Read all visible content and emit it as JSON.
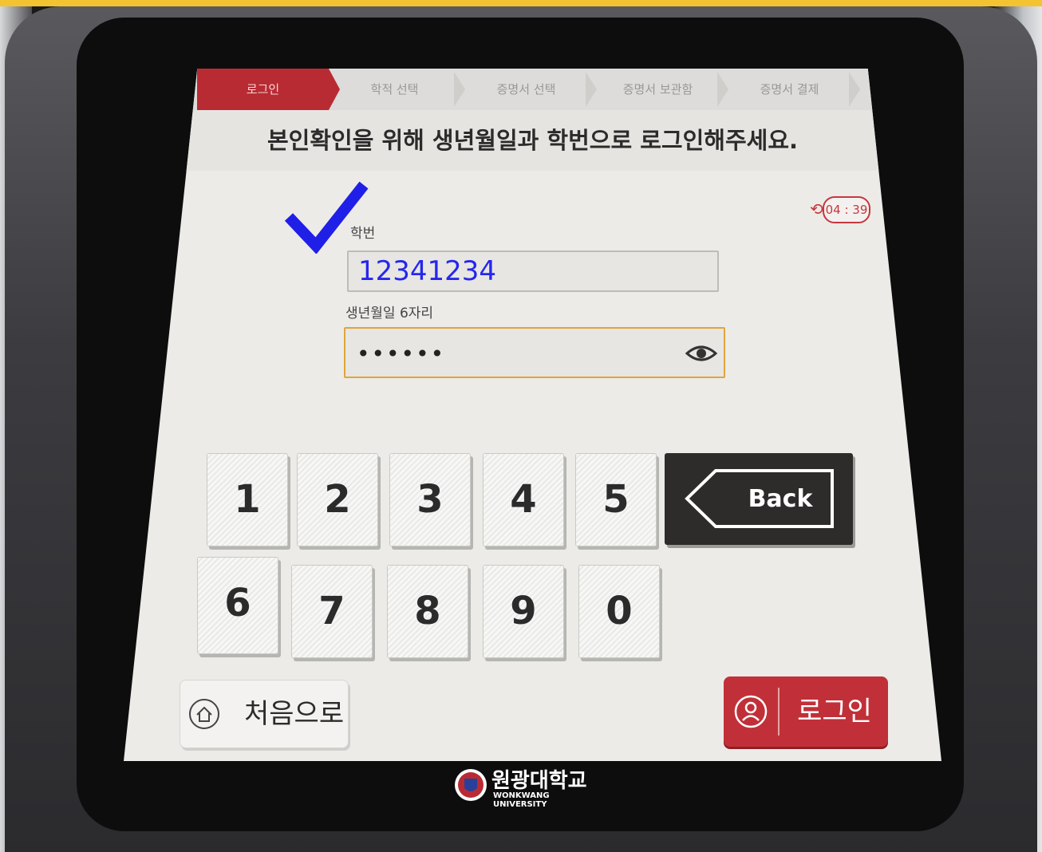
{
  "steps": [
    {
      "label": "로그인",
      "active": true
    },
    {
      "label": "학적 선택",
      "active": false
    },
    {
      "label": "증명서 선택",
      "active": false
    },
    {
      "label": "증명서 보관함",
      "active": false
    },
    {
      "label": "증명서 결제",
      "active": false
    }
  ],
  "instruction": "본인확인을 위해 생년월일과 학번으로 로그인해주세요.",
  "timer": "04 : 39",
  "student_id": {
    "label": "학번",
    "value": "12341234"
  },
  "birthdate": {
    "label": "생년월일 6자리",
    "value": "••••••"
  },
  "keypad": {
    "keys": [
      "1",
      "2",
      "3",
      "4",
      "5",
      "6",
      "7",
      "8",
      "9",
      "0"
    ],
    "back_label": "Back"
  },
  "home_button": {
    "label": "처음으로"
  },
  "login_button": {
    "label": "로그인"
  },
  "brand": {
    "name": "원광대학교",
    "english": "WONKWANG UNIVERSITY"
  },
  "colors": {
    "accent_red": "#c13038",
    "focus_orange": "#e0a53a",
    "checkmark_blue": "#1f1fe8",
    "value_blue": "#2626ee"
  },
  "icons": [
    "checkmark-icon",
    "timer-icon",
    "eye-icon",
    "back-arrow-icon",
    "home-icon",
    "user-icon",
    "university-seal-icon"
  ]
}
